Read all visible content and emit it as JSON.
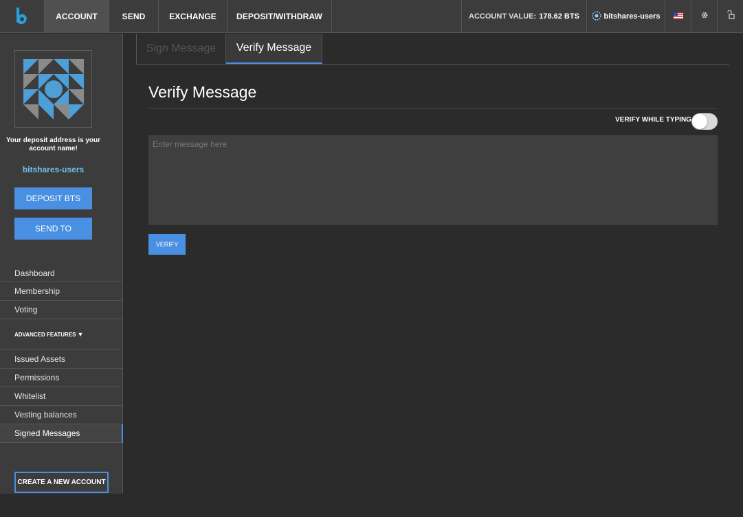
{
  "topbar": {
    "nav": [
      "ACCOUNT",
      "SEND",
      "EXCHANGE",
      "DEPOSIT/WITHDRAW"
    ],
    "account_value_label": "ACCOUNT VALUE:",
    "account_value": "178.62 BTS",
    "account_name": "bitshares-users",
    "icons": [
      "bitshares-logo-icon",
      "us-flag-icon",
      "gear-icon",
      "unlock-icon"
    ],
    "accent": "#4a90e2"
  },
  "sidebar": {
    "deposit_note": "Your deposit address is your account name!",
    "account_name": "bitshares-users",
    "deposit_button": "DEPOSIT BTS",
    "send_button": "SEND TO",
    "menu": [
      "Dashboard",
      "Membership",
      "Voting"
    ],
    "advanced_label": "ADVANCED FEATURES",
    "advanced_menu": [
      "Issued Assets",
      "Permissions",
      "Whitelist",
      "Vesting balances",
      "Signed Messages"
    ],
    "create_button": "CREATE A NEW ACCOUNT"
  },
  "main": {
    "tabs": [
      "Sign Message",
      "Verify Message"
    ],
    "title": "Verify Message",
    "toggle_label": "VERIFY WHILE TYPING",
    "message_placeholder": "Enter message here",
    "verify_button": "VERIFY"
  }
}
